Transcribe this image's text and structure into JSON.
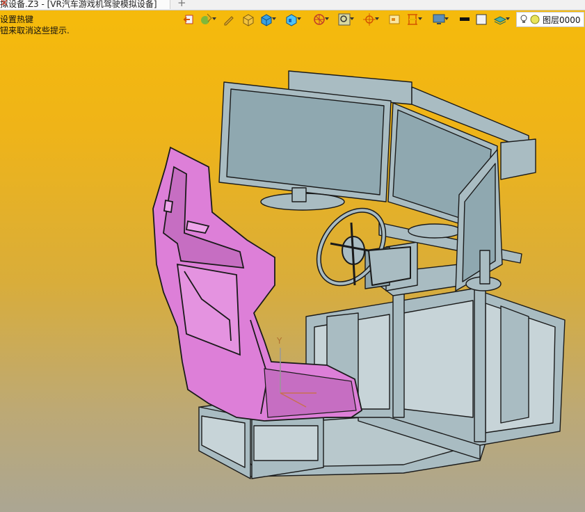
{
  "tab": {
    "title": "拟设备.Z3 - [VR汽车游戏机驾驶模拟设备]",
    "close": "✕",
    "add": "+"
  },
  "hints": [
    "设置热键",
    "钮来取消这些提示."
  ],
  "toolbar": {
    "icons": [
      "exit-icon",
      "paint-icon",
      "pencil-icon",
      "solid-box-icon",
      "blue-cube-icon",
      "view-cube-icon",
      "wireframe-sphere-icon",
      "zoom-frame-icon",
      "target-icon",
      "rectangle-icon",
      "section-icon",
      "display-icon",
      "color-swatch-black",
      "color-swatch-white",
      "layer-stack-icon"
    ]
  },
  "layer": {
    "label": "图层0000"
  },
  "axis": {
    "y_label": "Y"
  },
  "colors": {
    "seat": "#dd7fd8",
    "frame": "#a9bcc2",
    "outline": "#1a1a1a",
    "bg_top": "#f6bb0a",
    "bg_bottom": "#aba693"
  }
}
